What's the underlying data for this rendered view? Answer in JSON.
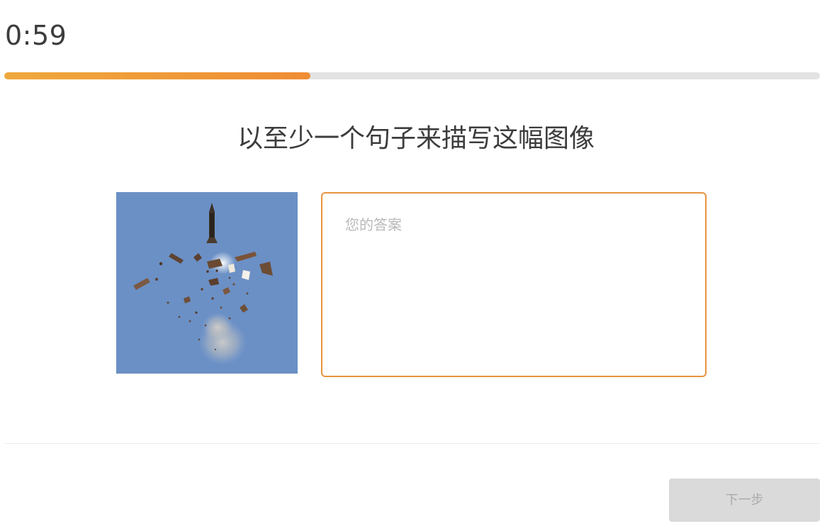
{
  "timer": {
    "time": "0:59"
  },
  "progress": {
    "fraction": 0.375,
    "color": "#ef8d34"
  },
  "question": {
    "prompt": "以至少一个句子来描写这幅图像"
  },
  "image": {
    "subject": "rocket-explosion-photo",
    "background_color": "#6b90c5"
  },
  "answer": {
    "value": "",
    "placeholder": "您的答案"
  },
  "footer": {
    "next_label": "下一步"
  }
}
